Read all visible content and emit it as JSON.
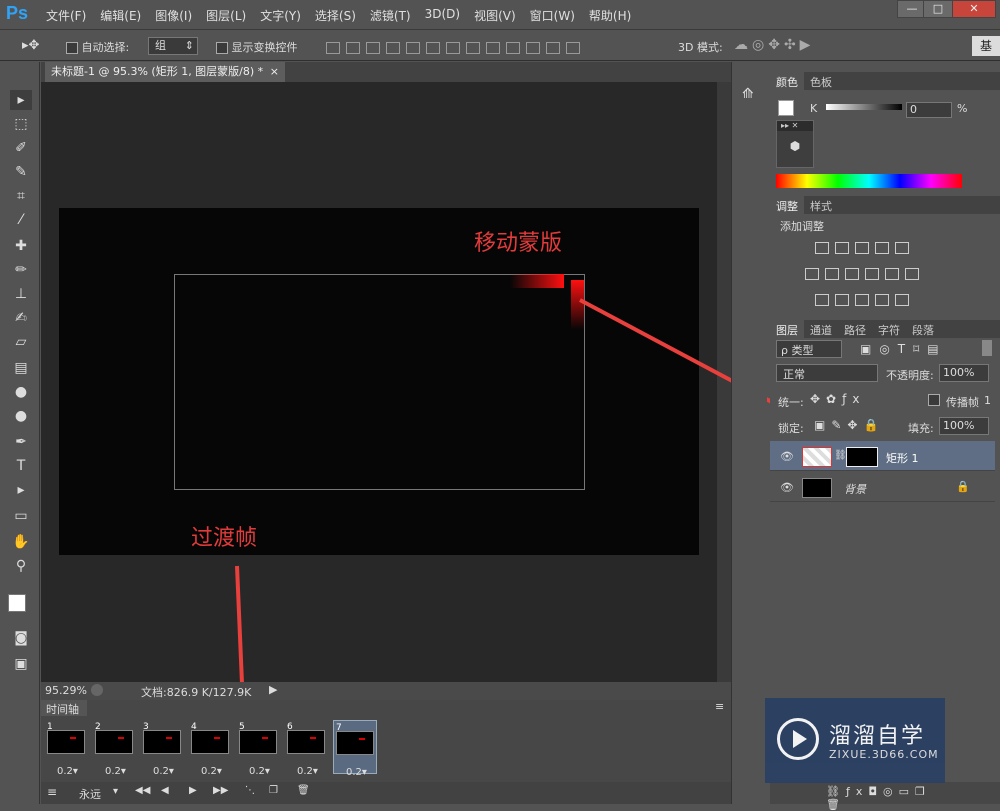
{
  "app": {
    "logo": "Ps"
  },
  "menu": [
    "文件(F)",
    "编辑(E)",
    "图像(I)",
    "图层(L)",
    "文字(Y)",
    "选择(S)",
    "滤镜(T)",
    "3D(D)",
    "视图(V)",
    "窗口(W)",
    "帮助(H)"
  ],
  "window_controls": [
    "—",
    "□",
    "✕"
  ],
  "options": {
    "auto_select": "自动选择:",
    "group_value": "组",
    "show_transform": "显示变换控件",
    "mode3d": "3D 模式:",
    "workspace": "基"
  },
  "doc": {
    "tab_title": "未标题-1 @ 95.3% (矩形 1, 图层蒙版/8) *",
    "close": "×"
  },
  "annotations": {
    "move_mask": "移动蒙版",
    "transition": "过渡帧"
  },
  "status": {
    "zoom": "95.29%",
    "docsize": "文档:826.9 K/127.9K"
  },
  "timeline": {
    "title": "时间轴",
    "frames": [
      {
        "num": "1",
        "dur": "0.2▾"
      },
      {
        "num": "2",
        "dur": "0.2▾"
      },
      {
        "num": "3",
        "dur": "0.2▾"
      },
      {
        "num": "4",
        "dur": "0.2▾"
      },
      {
        "num": "5",
        "dur": "0.2▾"
      },
      {
        "num": "6",
        "dur": "0.2▾"
      },
      {
        "num": "7",
        "dur": "0.2▾"
      }
    ],
    "loop": "永远"
  },
  "color_panel": {
    "tabs": [
      "颜色",
      "色板"
    ],
    "channel": "K",
    "value": "0",
    "unit": "%"
  },
  "adjust_panel": {
    "tabs": [
      "调整",
      "样式"
    ],
    "add": "添加调整"
  },
  "layers_panel": {
    "tabs": [
      "图层",
      "通道",
      "路径",
      "字符",
      "段落"
    ],
    "kind": "ρ 类型",
    "blend": "正常",
    "opacity_label": "不透明度:",
    "opacity": "100%",
    "unify": "统一:",
    "propagate": "传播帧",
    "propagate_num": "1",
    "lock": "锁定:",
    "fill_label": "填充:",
    "fill": "100%",
    "layers": [
      {
        "name": "矩形 1"
      },
      {
        "name": "背景"
      }
    ]
  },
  "watermark": {
    "cn": "溜溜自学",
    "en": "ZIXUE.3D66.COM"
  }
}
